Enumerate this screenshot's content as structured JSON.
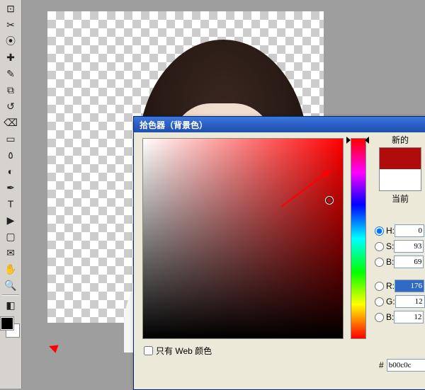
{
  "toolbar": {
    "tools": [
      {
        "name": "crop-ton",
        "glyph": "⊡"
      },
      {
        "name": "slice-tool",
        "glyph": "✂"
      },
      {
        "name": "eyedropper-tool",
        "glyph": "⦿"
      },
      {
        "name": "healing-brush-tool",
        "glyph": "✚"
      },
      {
        "name": "brush-tool",
        "glyph": "✎"
      },
      {
        "name": "clone-stamp-tool",
        "glyph": "⧉"
      },
      {
        "name": "history-brush-tool",
        "glyph": "↺"
      },
      {
        "name": "eraser-tool",
        "glyph": "⌫"
      },
      {
        "name": "gradient-tool",
        "glyph": "▭"
      },
      {
        "name": "blur-tool",
        "glyph": "٥"
      },
      {
        "name": "dodge-tool",
        "glyph": "◐"
      },
      {
        "name": "pen-tool",
        "glyph": "✒"
      },
      {
        "name": "type-tool",
        "glyph": "T"
      },
      {
        "name": "path-selection-tool",
        "glyph": "▶"
      },
      {
        "name": "shape-tool",
        "glyph": "▢"
      },
      {
        "name": "notes-tool",
        "glyph": "✉"
      },
      {
        "name": "hand-tool",
        "glyph": "✋"
      },
      {
        "name": "zoom-tool",
        "glyph": "🔍"
      }
    ]
  },
  "color_swatches": {
    "fg": "#000000",
    "bg": "#ffffff"
  },
  "dialog": {
    "title": "拾色器（背景色）",
    "preview": {
      "new_label": "新的",
      "current_label": "当前",
      "new_color": "#b00c0c",
      "current_color": "#ffffff"
    },
    "hsb": {
      "h_label": "H:",
      "s_label": "S:",
      "b_label": "B:",
      "h": "0",
      "s": "93",
      "b": "69"
    },
    "rgb": {
      "r_label": "R:",
      "g_label": "G:",
      "b_label": "B:",
      "r": "176",
      "g": "12",
      "b": "12"
    },
    "web_only_label": "只有 Web 颜色",
    "hex_prefix": "#",
    "hex": "b00c0c"
  }
}
